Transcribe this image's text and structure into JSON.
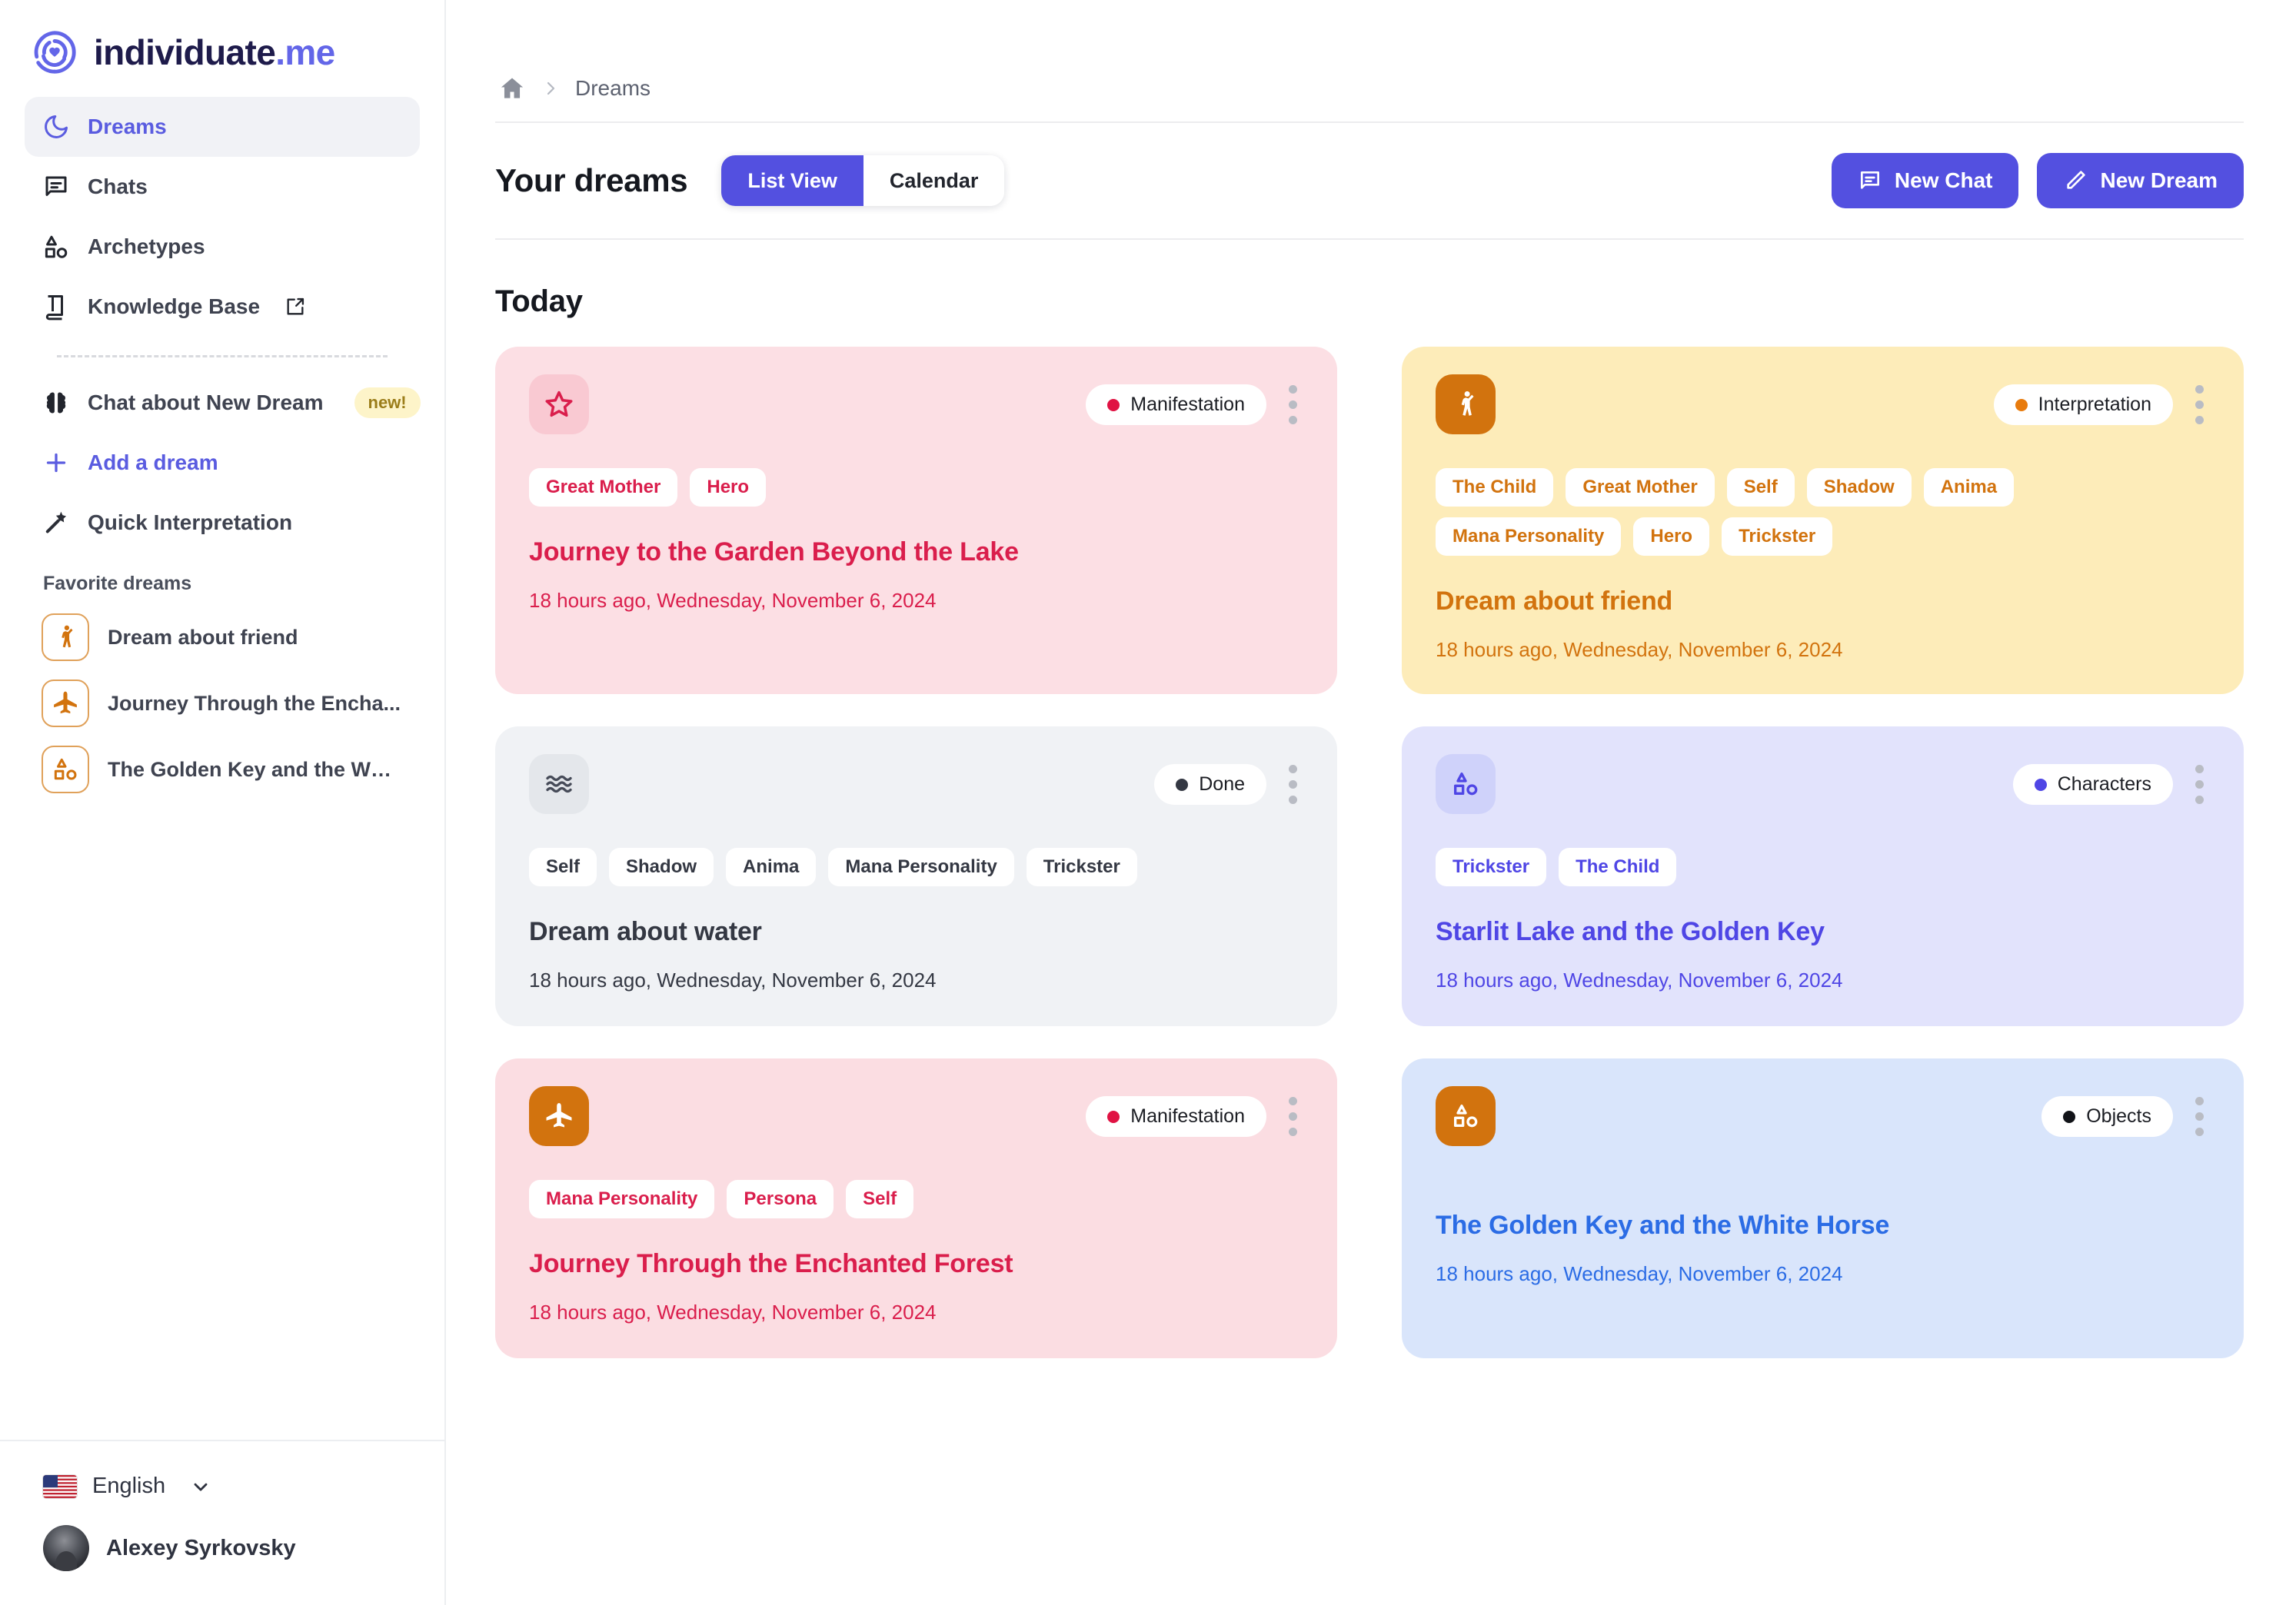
{
  "brand": {
    "name": "individuate",
    "suffix": ".me"
  },
  "sidebar": {
    "nav": [
      {
        "label": "Dreams",
        "icon": "moon-icon",
        "active": true
      },
      {
        "label": "Chats",
        "icon": "chat-icon",
        "active": false
      },
      {
        "label": "Archetypes",
        "icon": "shapes-icon",
        "active": false
      },
      {
        "label": "Knowledge Base",
        "icon": "book-icon",
        "active": false,
        "external": true
      }
    ],
    "actions": [
      {
        "label": "Chat about New Dream",
        "icon": "brain-icon",
        "badge": "new!"
      },
      {
        "label": "Add a dream",
        "icon": "plus-icon",
        "accent": true
      },
      {
        "label": "Quick Interpretation",
        "icon": "wand-icon"
      }
    ],
    "favorites_title": "Favorite dreams",
    "favorites": [
      {
        "label": "Dream about friend",
        "icon": "person-waving-icon"
      },
      {
        "label": "Journey Through the Encha...",
        "icon": "airplane-icon"
      },
      {
        "label": "The Golden Key and the Whi...",
        "icon": "shapes-icon"
      }
    ],
    "language": {
      "label": "English",
      "flag": "us-flag-icon"
    },
    "user": {
      "name": "Alexey Syrkovsky"
    }
  },
  "header": {
    "breadcrumb": {
      "home_icon": "home-icon",
      "current": "Dreams"
    },
    "page_title": "Your dreams",
    "view_tabs": [
      {
        "label": "List View",
        "selected": true
      },
      {
        "label": "Calendar",
        "selected": false
      }
    ],
    "buttons": [
      {
        "label": "New Chat",
        "icon": "chat-icon"
      },
      {
        "label": "New Dream",
        "icon": "pencil-icon"
      }
    ]
  },
  "content": {
    "group_title": "Today",
    "cards": [
      {
        "icon": "star-icon",
        "status": "Manifestation",
        "tags": [
          "Great Mother",
          "Hero"
        ],
        "title": "Journey to the Garden Beyond the Lake",
        "date": "18 hours ago, Wednesday, November 6, 2024",
        "theme": {
          "bg": "#fcdfe4",
          "accent": "#da1e4c",
          "tag_text": "#da1e4c",
          "icon_bg": "#f9c9d2",
          "icon_color": "#da1e4c",
          "dot": "#e01243",
          "status_text": "#1b1d23"
        }
      },
      {
        "icon": "person-waving-icon",
        "status": "Interpretation",
        "tags": [
          "The Child",
          "Great Mother",
          "Self",
          "Shadow",
          "Anima",
          "Mana Personality",
          "Hero",
          "Trickster"
        ],
        "title": "Dream about friend",
        "date": "18 hours ago, Wednesday, November 6, 2024",
        "theme": {
          "bg": "#fdecb9",
          "accent": "#d2730e",
          "tag_text": "#d2730e",
          "icon_bg": "#d2730e",
          "icon_color": "#ffffff",
          "dot": "#e87b0d",
          "status_text": "#1b1d23"
        }
      },
      {
        "icon": "waves-icon",
        "status": "Done",
        "tags": [
          "Self",
          "Shadow",
          "Anima",
          "Mana Personality",
          "Trickster"
        ],
        "title": "Dream about water",
        "date": "18 hours ago, Wednesday, November 6, 2024",
        "theme": {
          "bg": "#f0f2f5",
          "accent": "#343843",
          "tag_text": "#343843",
          "icon_bg": "#e4e7eb",
          "icon_color": "#464b58",
          "dot": "#343843",
          "status_text": "#1b1d23"
        }
      },
      {
        "icon": "shapes-icon",
        "status": "Characters",
        "tags": [
          "Trickster",
          "The Child"
        ],
        "title": "Starlit Lake and the Golden Key",
        "date": "18 hours ago, Wednesday, November 6, 2024",
        "theme": {
          "bg": "#e2e3fc",
          "accent": "#4f46e5",
          "tag_text": "#4f46e5",
          "icon_bg": "#cfd2fa",
          "icon_color": "#4f46e5",
          "dot": "#4f46e5",
          "status_text": "#1b1d23"
        }
      },
      {
        "icon": "airplane-icon",
        "status": "Manifestation",
        "tags": [
          "Mana Personality",
          "Persona",
          "Self"
        ],
        "title": "Journey Through the Enchanted Forest",
        "date": "18 hours ago, Wednesday, November 6, 2024",
        "theme": {
          "bg": "#fbdde2",
          "accent": "#da1e4c",
          "tag_text": "#da1e4c",
          "icon_bg": "#d2730e",
          "icon_color": "#ffffff",
          "dot": "#e01243",
          "status_text": "#1b1d23"
        }
      },
      {
        "icon": "shapes-icon",
        "status": "Objects",
        "tags": [],
        "title": "The Golden Key and the White Horse",
        "date": "18 hours ago, Wednesday, November 6, 2024",
        "theme": {
          "bg": "#d9e5fb",
          "accent": "#2b6ce5",
          "tag_text": "#2b6ce5",
          "icon_bg": "#d2730e",
          "icon_color": "#ffffff",
          "dot": "#111318",
          "status_text": "#1b1d23"
        }
      }
    ]
  }
}
